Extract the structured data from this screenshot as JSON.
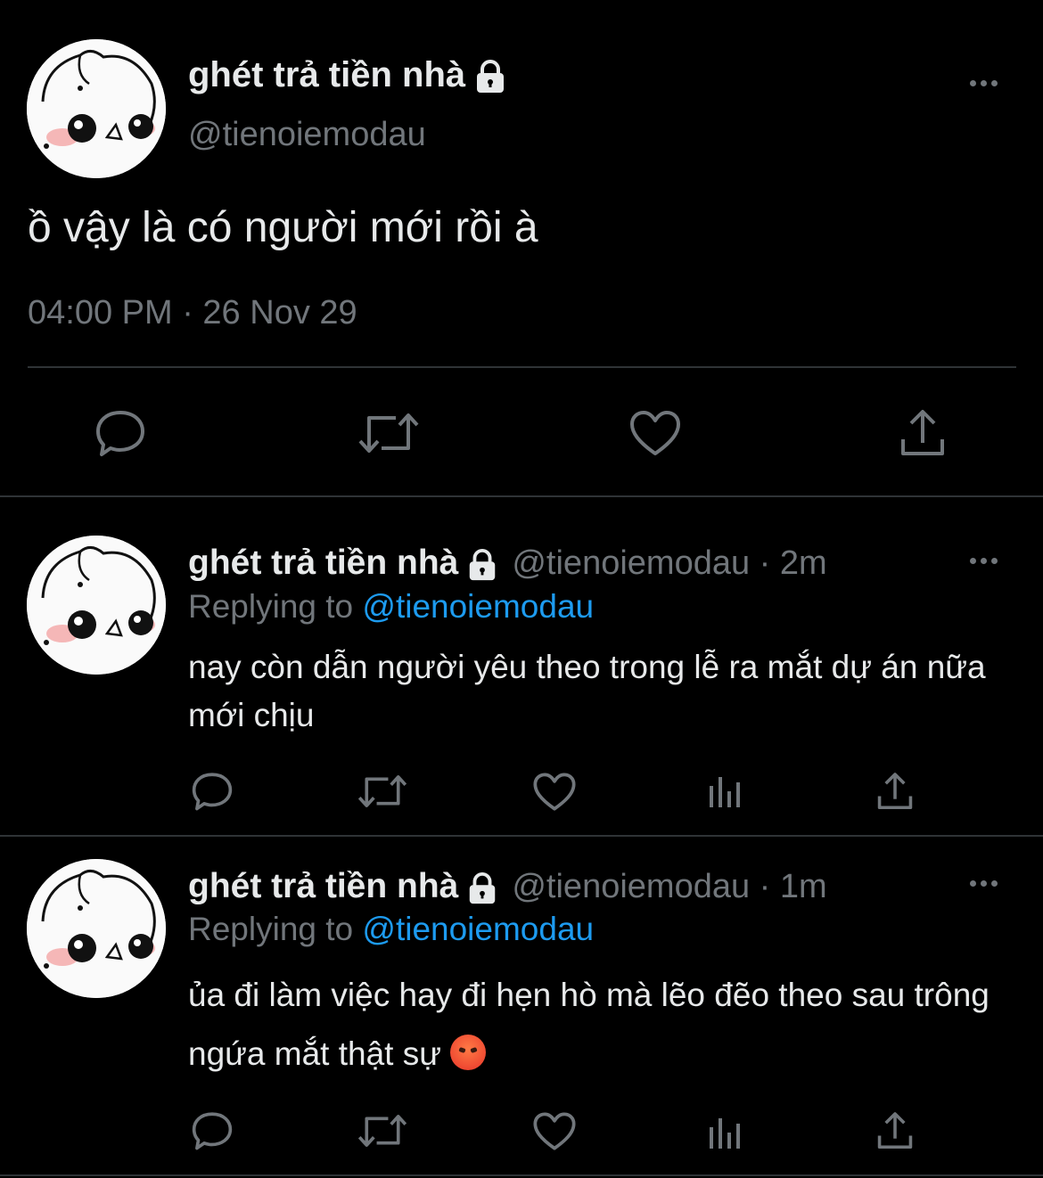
{
  "main_tweet": {
    "display_name": "ghét trả tiền nhà",
    "handle": "@tienoiemodau",
    "text": "ồ vậy là có người mới rồi à",
    "timestamp": "04:00 PM · 26 Nov 29",
    "actions": [
      "reply-icon",
      "retweet-icon",
      "like-icon",
      "share-icon"
    ]
  },
  "replies": [
    {
      "display_name": "ghét trả tiền nhà",
      "handle": "@tienoiemodau",
      "time": "· 2m",
      "replying_label": "Replying to",
      "replying_to": "@tienoiemodau",
      "text": "nay còn dẫn người yêu theo trong lễ ra mắt dự án nữa mới chịu"
    },
    {
      "display_name": "ghét trả tiền nhà",
      "handle": "@tienoiemodau",
      "time": "· 1m",
      "replying_label": "Replying to",
      "replying_to": "@tienoiemodau",
      "text": "ủa đi làm việc hay đi hẹn hò mà lẽo đẽo theo sau trông ngứa mắt thật sự",
      "emoji": "angry-face-emoji"
    }
  ],
  "colors": {
    "background": "#000000",
    "text": "#e7e9ea",
    "secondary": "#71767b",
    "accent": "#1d9bf0",
    "divider": "#2f3336"
  }
}
